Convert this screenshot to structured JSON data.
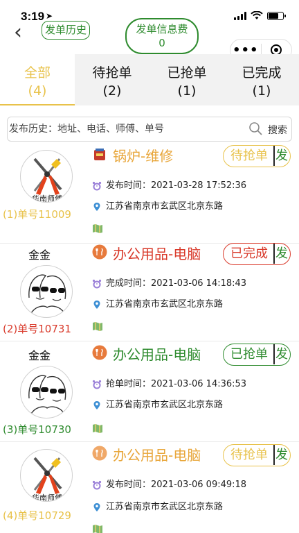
{
  "status_bar": {
    "time": "3:19"
  },
  "nav": {
    "history_label": "发单历史",
    "fee_label": "发单信息费",
    "fee_value": "0"
  },
  "tabs": [
    {
      "label": "全部",
      "count": "(4)"
    },
    {
      "label": "待抢单",
      "count": "(2)"
    },
    {
      "label": "已抢单",
      "count": "(1)"
    },
    {
      "label": "已完成",
      "count": "(1)"
    }
  ],
  "search": {
    "placeholder": "发布历史：地址、电话、师傅、单号",
    "button_label": "搜索"
  },
  "orders": [
    {
      "customer": "",
      "order_no": "(1)单号11009",
      "category": "锅炉-维修",
      "status": "待抢单",
      "status_suffix": "发",
      "time_text": "发布时间：2021-03-28 17:52:36",
      "address": "江苏省南京市玄武区北京东路"
    },
    {
      "customer": "金金",
      "order_no": "(2)单号10731",
      "category": "办公用品-电脑",
      "status": "已完成",
      "status_suffix": "发",
      "time_text": "完成时间：2021-03-06 14:18:43",
      "address": "江苏省南京市玄武区北京东路"
    },
    {
      "customer": "金金",
      "order_no": "(3)单号10730",
      "category": "办公用品-电脑",
      "status": "已抢单",
      "status_suffix": "发",
      "time_text": "抢单时间：2021-03-06 14:36:53",
      "address": "江苏省南京市玄武区北京东路"
    },
    {
      "customer": "",
      "order_no": "(4)单号10729",
      "category": "办公用品-电脑",
      "status": "待抢单",
      "status_suffix": "发",
      "time_text": "发布时间：2021-03-06 09:49:18",
      "address": "江苏省南京市玄武区北京东路"
    }
  ],
  "avatar_text": "华南师傅",
  "colors": {
    "green": "#2e8b2e",
    "gold": "#e8c24a",
    "red": "#d93a2b",
    "orange": "#f0a040"
  }
}
